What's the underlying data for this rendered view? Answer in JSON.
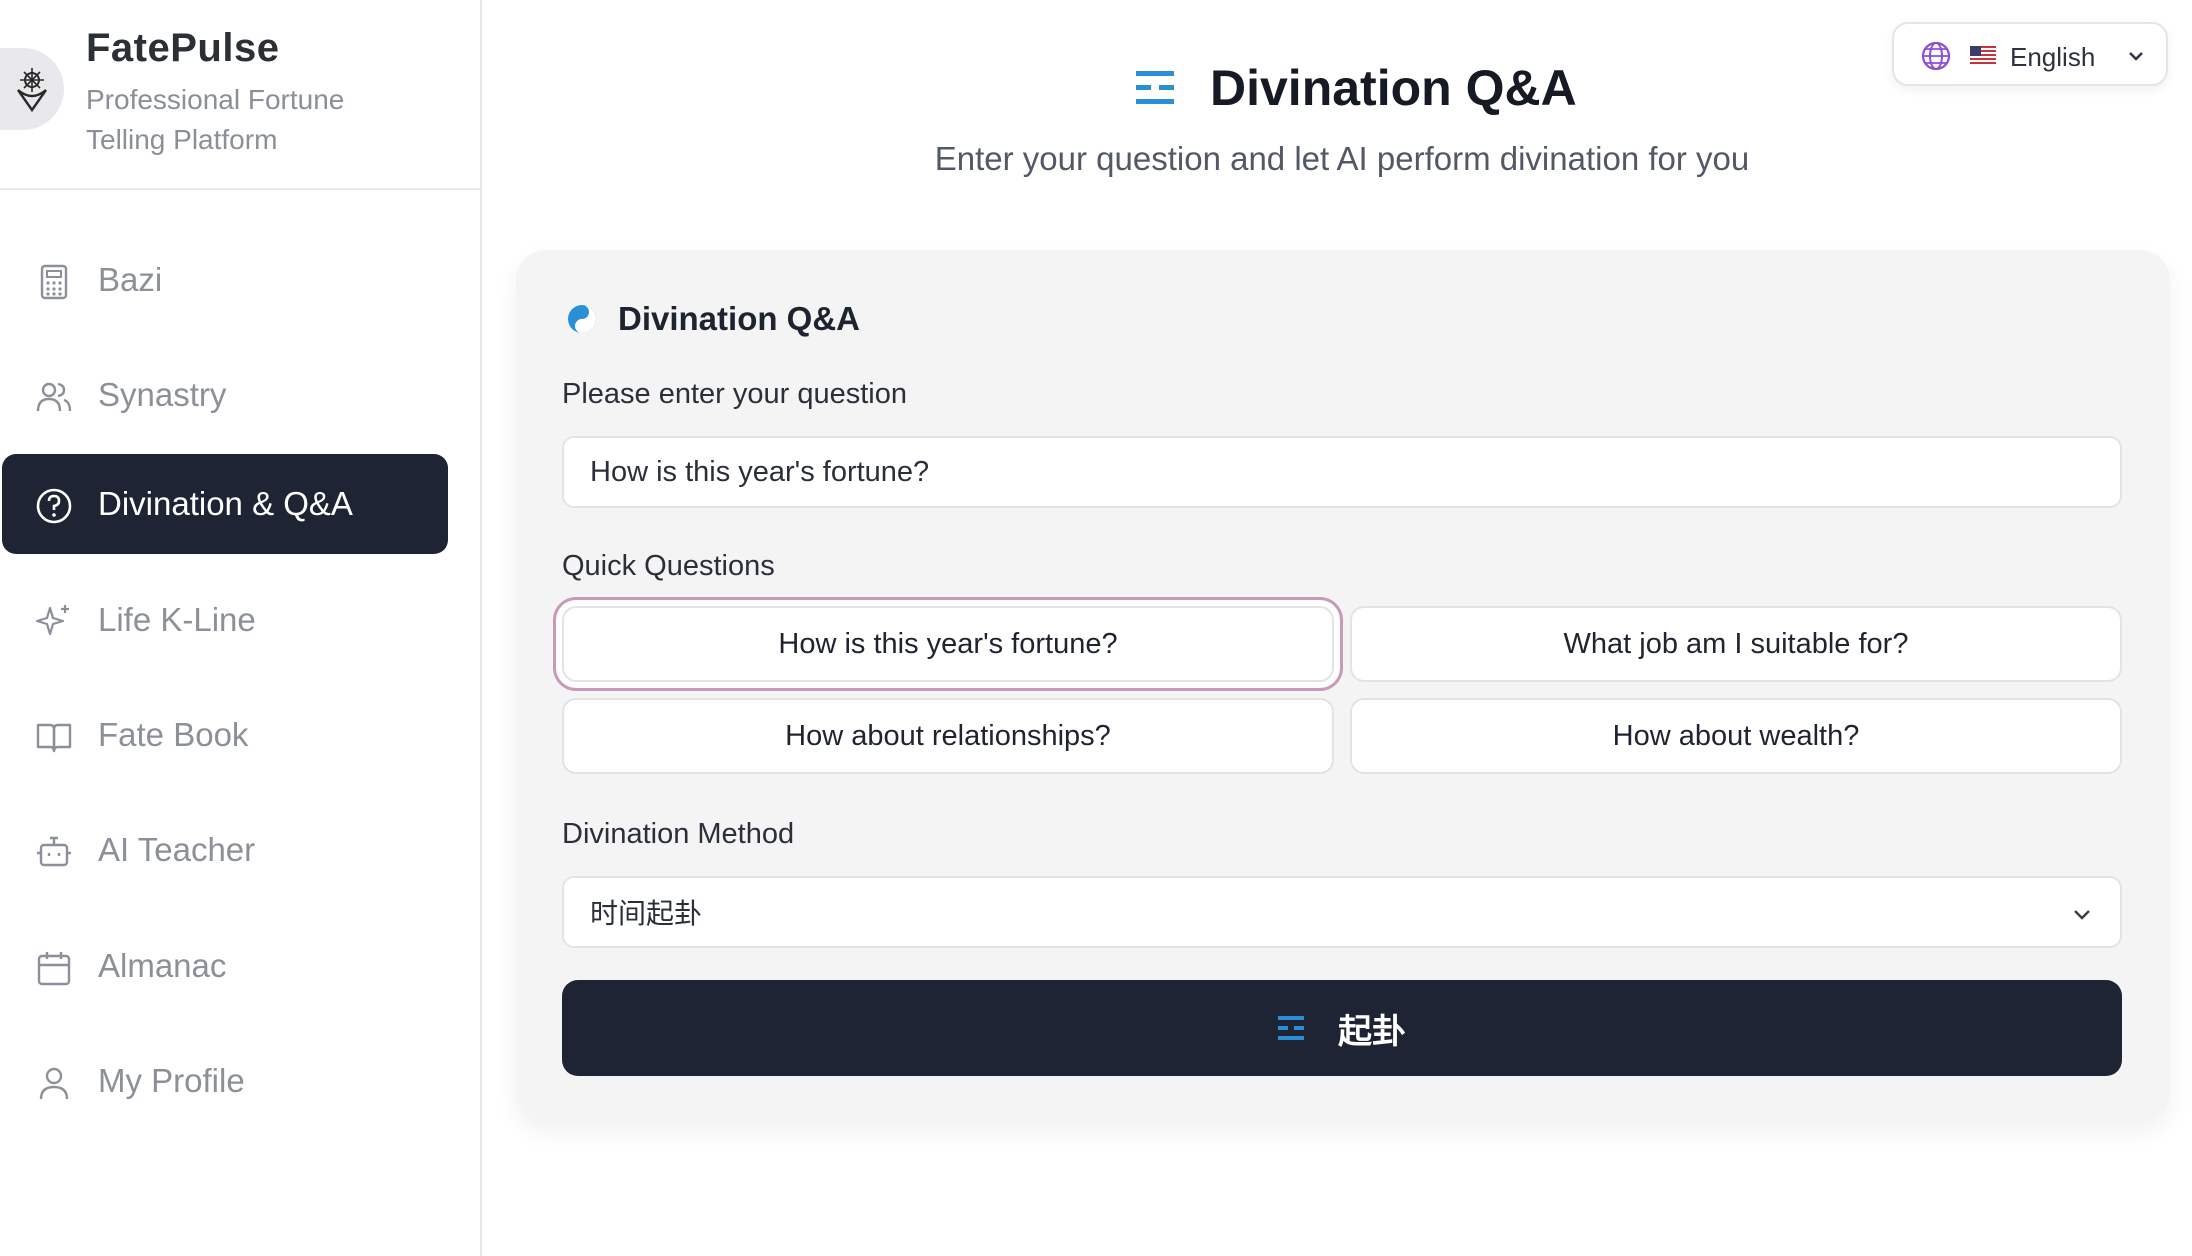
{
  "brand": {
    "name": "FatePulse",
    "tagline": "Professional Fortune Telling Platform"
  },
  "sidebar": {
    "items": [
      {
        "label": "Bazi",
        "icon": "calculator-icon"
      },
      {
        "label": "Synastry",
        "icon": "users-icon"
      },
      {
        "label": "Divination & Q&A",
        "icon": "question-circle-icon",
        "active": true
      },
      {
        "label": "Life K-Line",
        "icon": "sparkles-icon"
      },
      {
        "label": "Fate Book",
        "icon": "book-open-icon"
      },
      {
        "label": "AI Teacher",
        "icon": "robot-icon"
      },
      {
        "label": "Almanac",
        "icon": "calendar-icon"
      },
      {
        "label": "My Profile",
        "icon": "user-icon"
      }
    ]
  },
  "language": {
    "label": "English",
    "flag": "us-flag-icon"
  },
  "header": {
    "title": "Divination Q&A",
    "subtitle": "Enter your question and let AI perform divination for you"
  },
  "card": {
    "title": "Divination Q&A",
    "question_label": "Please enter your question",
    "question_value": "How is this year's fortune?",
    "quick_label": "Quick Questions",
    "quick_questions": [
      "How is this year's fortune?",
      "What job am I suitable for?",
      "How about relationships?",
      "How about wealth?"
    ],
    "method_label": "Divination Method",
    "method_value": "时间起卦",
    "submit_label": "起卦"
  },
  "colors": {
    "accent_blue": "#2b8fd6",
    "dark": "#1e2433",
    "focus_ring": "#c79ab8",
    "globe": "#8b4fd8"
  }
}
